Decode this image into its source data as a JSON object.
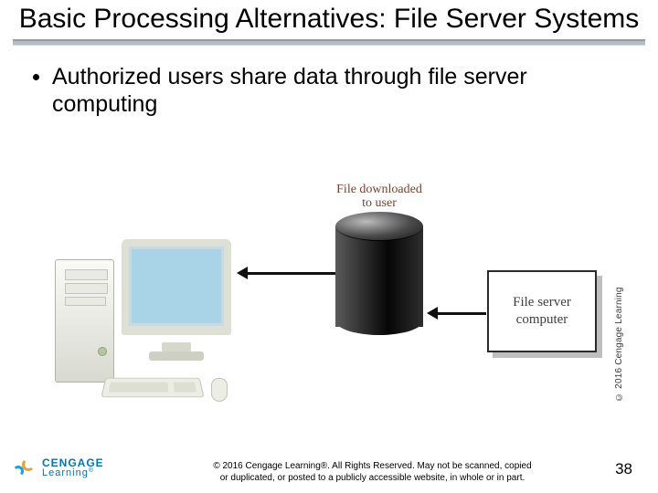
{
  "title": "Basic Processing Alternatives: File Server Systems",
  "bullet1": "Authorized users share data through file server computing",
  "diagram": {
    "downloaded_label_line1": "File downloaded",
    "downloaded_label_line2": "to user",
    "server_box_line1": "File server",
    "server_box_line2": "computer"
  },
  "logo": {
    "line1": "CENGAGE",
    "line2": "Learning",
    "reg": "®"
  },
  "side_credit": "© 2016 Cengage Learning",
  "copyright_line1": "© 2016 Cengage Learning®. All Rights Reserved. May not be scanned, copied",
  "copyright_line2": "or duplicated, or posted to a publicly accessible website, in whole or in part.",
  "page_number": "38"
}
